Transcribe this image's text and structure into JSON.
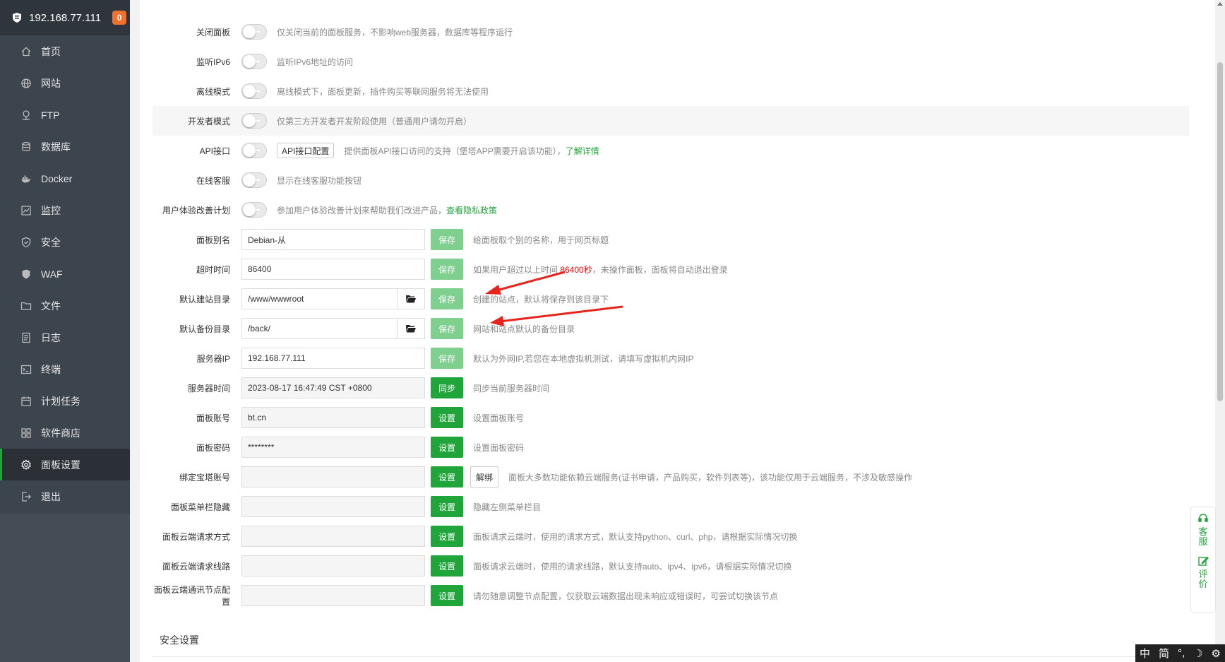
{
  "sidebar": {
    "server_ip": "192.168.77.111",
    "badge_count": "0",
    "items": [
      {
        "label": "首页",
        "icon": "home-icon"
      },
      {
        "label": "网站",
        "icon": "globe-icon"
      },
      {
        "label": "FTP",
        "icon": "ftp-icon"
      },
      {
        "label": "数据库",
        "icon": "database-icon"
      },
      {
        "label": "Docker",
        "icon": "docker-icon"
      },
      {
        "label": "监控",
        "icon": "monitor-icon"
      },
      {
        "label": "安全",
        "icon": "shield-icon"
      },
      {
        "label": "WAF",
        "icon": "waf-shield-icon"
      },
      {
        "label": "文件",
        "icon": "folder-icon"
      },
      {
        "label": "日志",
        "icon": "log-icon"
      },
      {
        "label": "终端",
        "icon": "terminal-icon"
      },
      {
        "label": "计划任务",
        "icon": "calendar-icon"
      },
      {
        "label": "软件商店",
        "icon": "apps-icon"
      },
      {
        "label": "面板设置",
        "icon": "gear-icon",
        "active": true
      },
      {
        "label": "退出",
        "icon": "logout-icon"
      }
    ]
  },
  "settings": {
    "close_panel": {
      "label": "关闭面板",
      "desc": "仅关闭当前的面板服务，不影响web服务器，数据库等程序运行"
    },
    "ipv6": {
      "label": "监听IPv6",
      "desc": "监听IPv6地址的访问"
    },
    "offline": {
      "label": "离线模式",
      "desc": "离线模式下，面板更新，插件购买等联网服务将无法使用"
    },
    "developer": {
      "label": "开发者模式",
      "desc": "仅第三方开发者开发阶段使用（普通用户请勿开启）"
    },
    "api": {
      "label": "API接口",
      "config_button": "API接口配置",
      "desc": "提供面板API接口访问的支持（堡塔APP需要开启该功能），",
      "link": "了解详情"
    },
    "online_service": {
      "label": "在线客服",
      "desc": "显示在线客服功能按钮"
    },
    "ux_plan": {
      "label": "用户体验改善计划",
      "desc": "参加用户体验改善计划来帮助我们改进产品，",
      "link": "查看隐私政策"
    },
    "alias": {
      "label": "面板别名",
      "value": "Debian-从",
      "button": "保存",
      "desc": "给面板取个别的名称，用于网页标题"
    },
    "timeout": {
      "label": "超时时间",
      "value": "86400",
      "button": "保存",
      "desc_before": "如果用户超过以上时间 ",
      "desc_red": "86400秒",
      "desc_after": "，未操作面板，面板将自动退出登录"
    },
    "site_dir": {
      "label": "默认建站目录",
      "value": "/www/wwwroot",
      "button": "保存",
      "desc": "创建的站点，默认将保存到该目录下"
    },
    "backup_dir": {
      "label": "默认备份目录",
      "value": "/back/",
      "button": "保存",
      "desc": "网站和站点默认的备份目录"
    },
    "server_ip": {
      "label": "服务器IP",
      "value": "192.168.77.111",
      "button": "保存",
      "desc": "默认为外网IP,若您在本地虚拟机测试，请填写虚拟机内网IP"
    },
    "server_time": {
      "label": "服务器时间",
      "value": "2023-08-17 16:47:49 CST +0800",
      "button": "同步",
      "desc": "同步当前服务器时间"
    },
    "account": {
      "label": "面板账号",
      "value": "bt.cn",
      "button": "设置",
      "desc": "设置面板账号"
    },
    "password": {
      "label": "面板密码",
      "value": "********",
      "button": "设置",
      "desc": "设置面板密码"
    },
    "bind_bt": {
      "label": "绑定宝塔账号",
      "value": "",
      "button": "设置",
      "unbind_button": "解绑",
      "desc": "面板大多数功能依赖云端服务(证书申请，产品购买，软件列表等)，该功能仅用于云端服务，不涉及敏感操作"
    },
    "menu_hide": {
      "label": "面板菜单栏隐藏",
      "value": "",
      "button": "设置",
      "desc": "隐藏左侧菜单栏目"
    },
    "cloud_method": {
      "label": "面板云端请求方式",
      "value": "",
      "button": "设置",
      "desc": "面板请求云端时，使用的请求方式，默认支持python、curl、php，请根据实际情况切换"
    },
    "cloud_line": {
      "label": "面板云端请求线路",
      "value": "",
      "button": "设置",
      "desc": "面板请求云端时，使用的请求线路，默认支持auto、ipv4、ipv6，请根据实际情况切换"
    },
    "cloud_node": {
      "label": "面板云端通讯节点配置",
      "value": "",
      "button": "设置",
      "desc": "请勿随意调整节点配置，仅获取云端数据出现未响应或错误时，可尝试切换该节点"
    }
  },
  "section_title": "安全设置",
  "float_panel": {
    "service": "客服",
    "review": "评价"
  },
  "ime": {
    "lang": "中",
    "mode": "简"
  },
  "colors": {
    "accent": "#20a53a",
    "sidebar": "#3c444d",
    "red": "#ef0808"
  }
}
